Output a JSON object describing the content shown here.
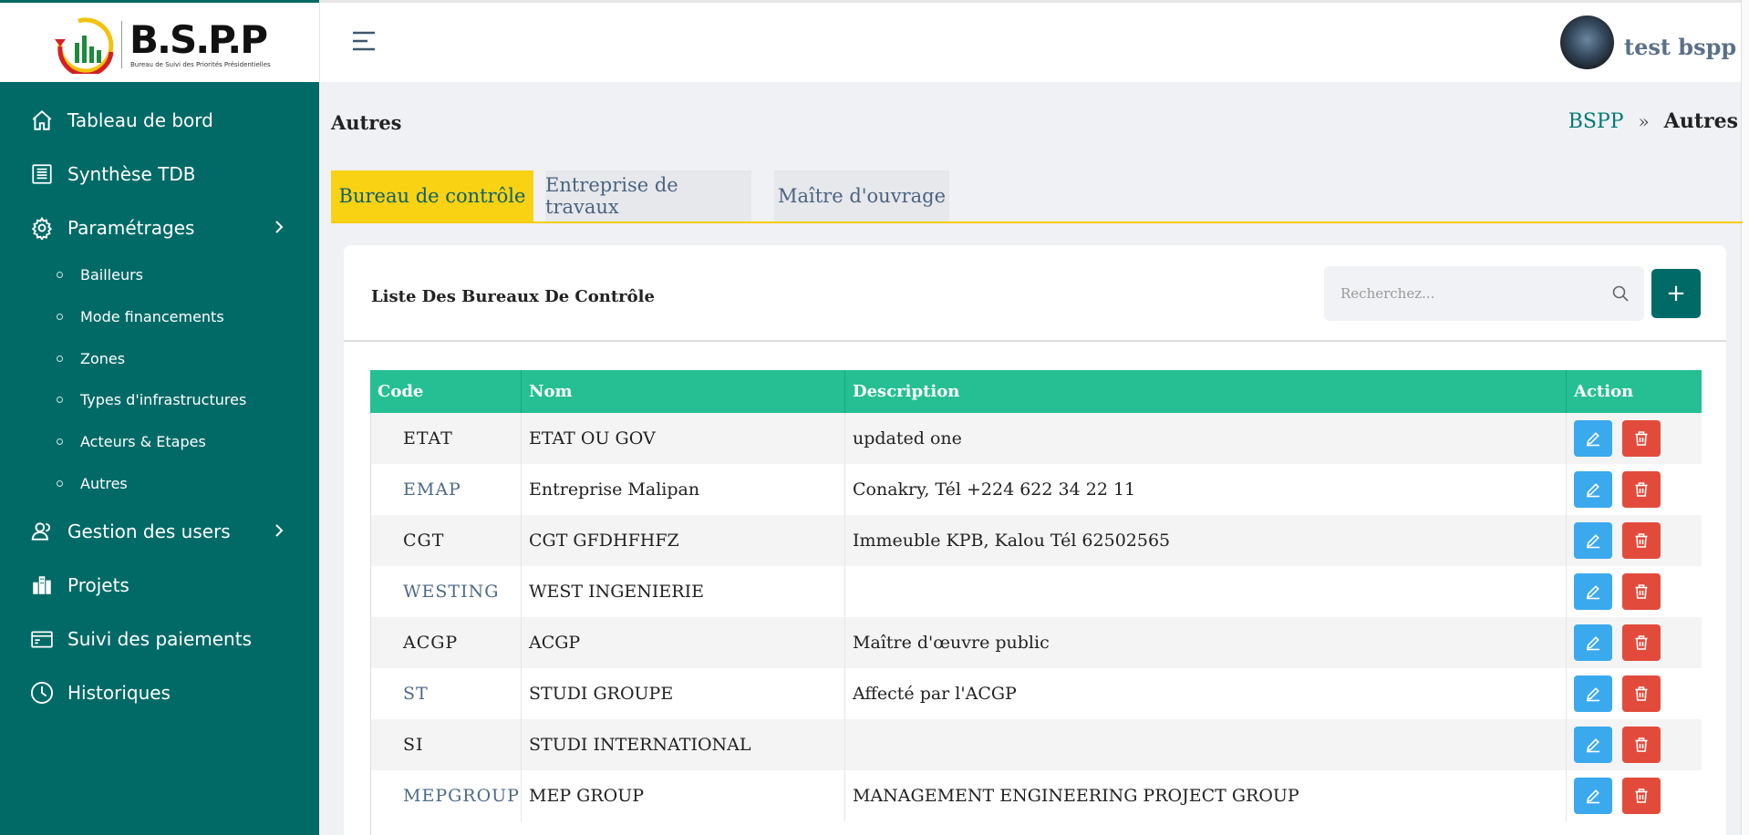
{
  "brand": {
    "name": "B.S.P.P",
    "subtitle": "Bureau de Suivi des Priorités Présidentielles"
  },
  "colors": {
    "sidebar": "#016a67",
    "accent_tab": "#f8d213",
    "table_header": "#25bf93",
    "edit": "#3ba9ee",
    "delete": "#e24b3b",
    "add_button": "#006b66"
  },
  "sidebar": {
    "items": [
      {
        "label": "Tableau de bord",
        "icon": "home-icon"
      },
      {
        "label": "Synthèse TDB",
        "icon": "list-icon"
      },
      {
        "label": "Paramétrages",
        "icon": "gear-icon",
        "expandable": true
      },
      {
        "label": "Gestion des users",
        "icon": "users-icon",
        "expandable": true
      },
      {
        "label": "Projets",
        "icon": "building-icon"
      },
      {
        "label": "Suivi des paiements",
        "icon": "payment-card-icon"
      },
      {
        "label": "Historiques",
        "icon": "history-icon"
      }
    ],
    "subitems": [
      "Bailleurs",
      "Mode financements",
      "Zones",
      "Types d'infrastructures",
      "Acteurs & Etapes",
      "Autres"
    ]
  },
  "header": {
    "user_name": "test bspp"
  },
  "page": {
    "title": "Autres",
    "breadcrumb": {
      "root": "BSPP",
      "current": "Autres"
    }
  },
  "tabs": [
    "Bureau de contrôle",
    "Entreprise de travaux",
    "Maître d'ouvrage"
  ],
  "card": {
    "title": "Liste Des Bureaux De Contrôle",
    "search_placeholder": "Recherchez...",
    "add_label": "+"
  },
  "table": {
    "headers": [
      "Code",
      "Nom",
      "Description",
      "Action"
    ],
    "rows": [
      {
        "code": "ETAT",
        "nom": "ETAT OU GOV",
        "description": "updated one"
      },
      {
        "code": "EMAP",
        "nom": "Entreprise Malipan",
        "description": "Conakry, Tél +224 622 34 22 11"
      },
      {
        "code": "CGT",
        "nom": "CGT GFDHFHFZ",
        "description": "Immeuble KPB, Kalou Tél 62502565"
      },
      {
        "code": "WESTING",
        "nom": "WEST INGENIERIE",
        "description": ""
      },
      {
        "code": "ACGP",
        "nom": "ACGP",
        "description": "Maître d'œuvre public"
      },
      {
        "code": "ST",
        "nom": "STUDI GROUPE",
        "description": "Affecté par l'ACGP"
      },
      {
        "code": "SI",
        "nom": "STUDI INTERNATIONAL",
        "description": ""
      },
      {
        "code": "MEPGROUP",
        "nom": "MEP GROUP",
        "description": "MANAGEMENT ENGINEERING PROJECT GROUP"
      }
    ]
  }
}
